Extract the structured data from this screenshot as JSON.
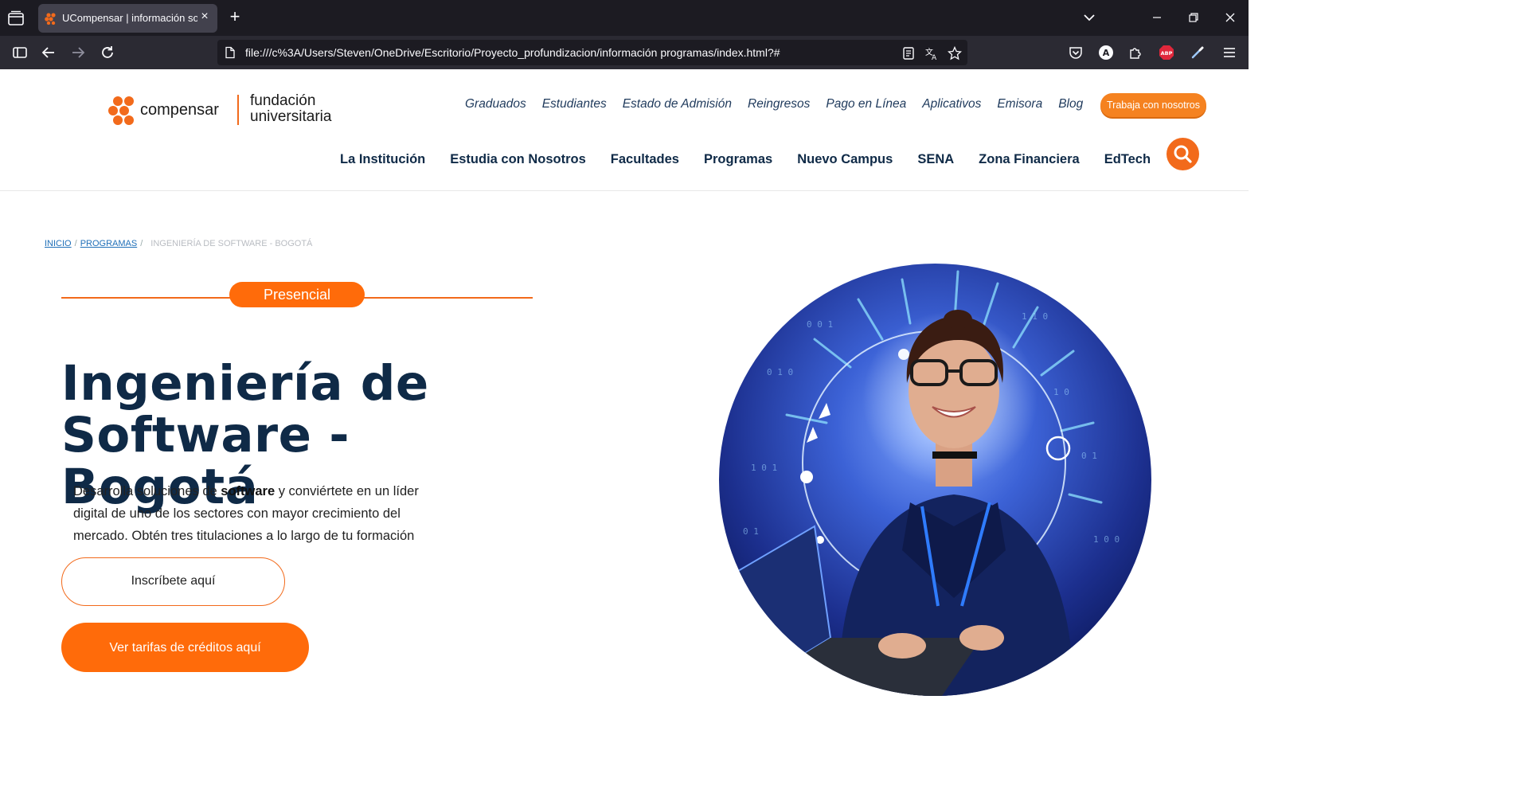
{
  "browser": {
    "tab_title": "UCompensar | información sobr",
    "url": "file:///c%3A/Users/Steven/OneDrive/Escritorio/Proyecto_profundizacion/información programas/index.html?#",
    "ext_abp_label": "ABP",
    "ext_account_label": "A"
  },
  "logo": {
    "brand": "compensar",
    "sub_line1": "fundación",
    "sub_line2": "universitaria"
  },
  "top_links": [
    "Graduados",
    "Estudiantes",
    "Estado de Admisión",
    "Reingresos",
    "Pago en Línea",
    "Aplicativos",
    "Emisora",
    "Blog"
  ],
  "work_button": "Trabaja con nosotros",
  "main_nav": [
    "La Institución",
    "Estudia con Nosotros",
    "Facultades",
    "Programas",
    "Nuevo Campus",
    "SENA",
    "Zona Financiera",
    "EdTech"
  ],
  "breadcrumb": {
    "home": "INICIO",
    "programs": "PROGRAMAS",
    "current": "INGENIERÍA DE SOFTWARE - BOGOTÁ"
  },
  "program": {
    "mode": "Presencial",
    "title_line1": "Ingeniería de",
    "title_line2": "Software - Bogotá",
    "desc_before": "Desarrolla soluciones de ",
    "desc_bold": "software",
    "desc_after": " y conviértete en un líder digital de uno de los sectores con mayor crecimiento del mercado. Obtén tres titulaciones a lo largo de tu formación",
    "enroll_button": "Inscríbete aquí",
    "tariffs_button": "Ver tarifas de créditos aquí"
  },
  "colors": {
    "accent": "#f26a1b",
    "navy": "#0f2a47",
    "chrome_dark": "#1c1b22"
  }
}
